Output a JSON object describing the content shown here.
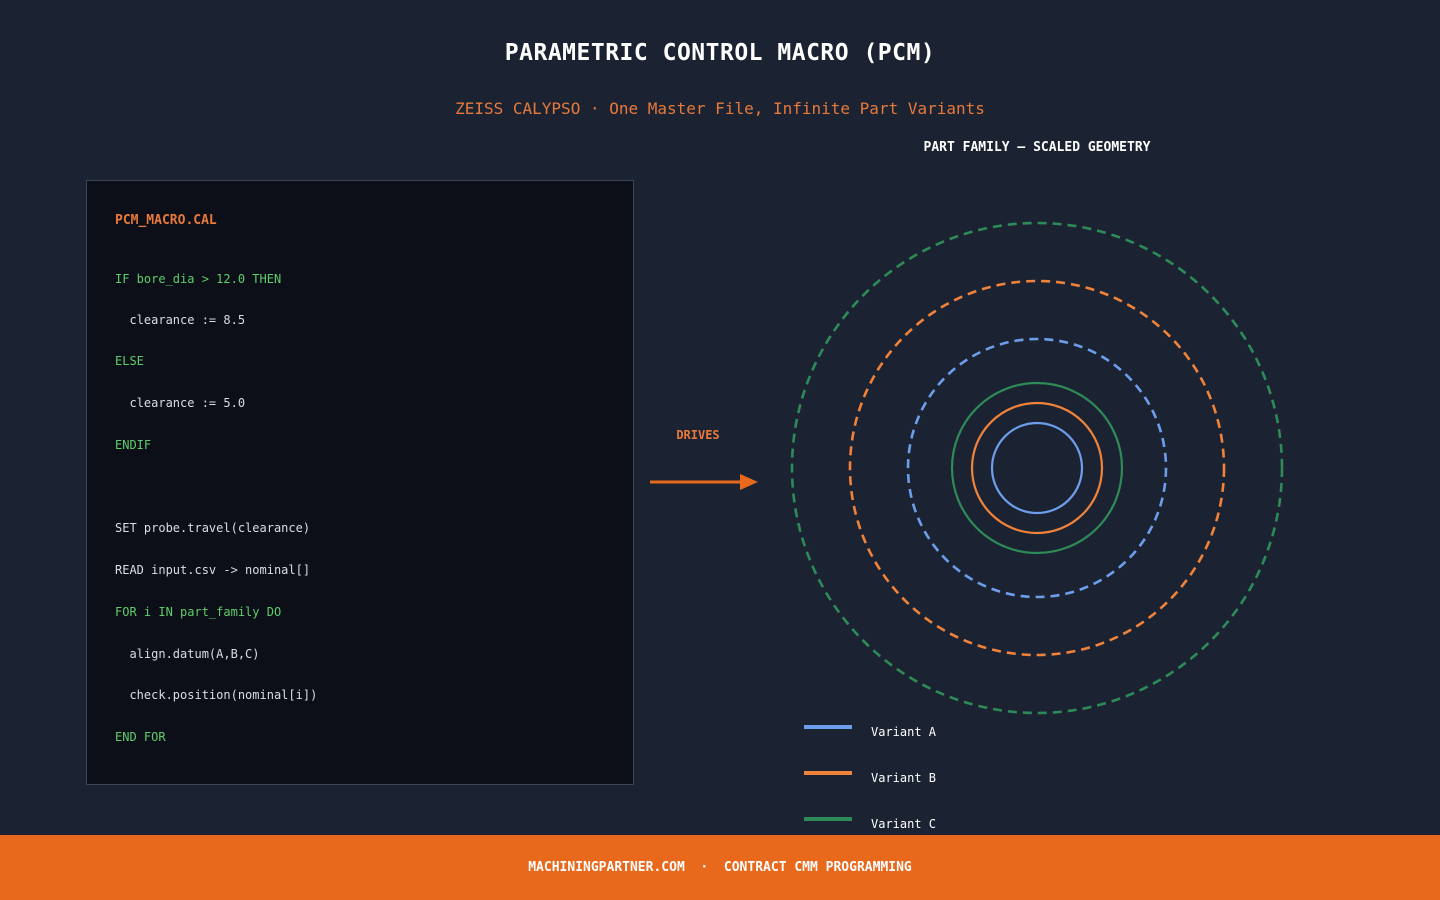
{
  "header": {
    "title": "PARAMETRIC CONTROL MACRO (PCM)",
    "subtitle": "ZEISS CALYPSO · One Master File, Infinite Part Variants"
  },
  "code": {
    "filename": "PCM_MACRO.CAL",
    "lines": [
      "IF bore_dia > 12.0 THEN",
      "  clearance := 8.5",
      "ELSE",
      "  clearance := 5.0",
      "ENDIF",
      "",
      "SET probe.travel(clearance)",
      "READ input.csv -> nominal[]",
      "FOR i IN part_family DO",
      "  align.datum(A,B,C)",
      "  check.position(nominal[i])",
      "END FOR"
    ]
  },
  "arrow": {
    "label": "DRIVES"
  },
  "part_family": {
    "title": "PART FAMILY — SCALED GEOMETRY",
    "variants": [
      {
        "name": "Variant A",
        "color": "#6d9eeb"
      },
      {
        "name": "Variant B",
        "color": "#f0823a"
      },
      {
        "name": "Variant C",
        "color": "#2e8b57"
      }
    ]
  },
  "footer": {
    "text": "MACHININGPARTNER.COM  ·  CONTRACT CMM PROGRAMMING"
  },
  "colors": {
    "background": "#1b2332",
    "code_background": "#0c0f17",
    "accent_orange": "#e8681c",
    "keyword_green": "#5dce6c"
  }
}
